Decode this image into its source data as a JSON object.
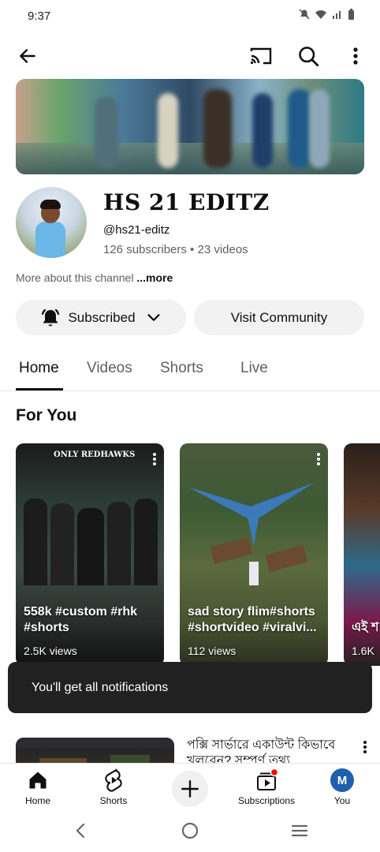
{
  "status_bar": {
    "time": "9:37"
  },
  "channel": {
    "name": "HS 21 EDITZ",
    "handle": "@hs21-editz",
    "stats": "126 subscribers • 23 videos",
    "about_prefix": "More about this channel",
    "about_more": "...more"
  },
  "actions": {
    "subscribed_label": "Subscribed",
    "visit_community_label": "Visit Community"
  },
  "tabs": [
    {
      "label": "Home",
      "active": true
    },
    {
      "label": "Videos",
      "active": false
    },
    {
      "label": "Shorts",
      "active": false
    },
    {
      "label": "Live",
      "active": false
    }
  ],
  "section": {
    "title": "For You"
  },
  "shorts": [
    {
      "title": "558k #custom #rhk #shorts",
      "views": "2.5K views",
      "overlay_text": "ONLY REDHAWKS"
    },
    {
      "title": "sad story flim#shorts #shortvideo #viralvi...",
      "views": "112 views"
    },
    {
      "title": "এই শ দুইটা",
      "views": "1.6K"
    }
  ],
  "toast": {
    "message": "You'll get all notifications"
  },
  "video": {
    "title": "পক্সি সার্ভারে একাউন্ট কিভাবে খুলবেন? সম্পূর্ণ তথ্য"
  },
  "bottom_nav": {
    "home": "Home",
    "shorts": "Shorts",
    "subscriptions": "Subscriptions",
    "you": "You",
    "you_initial": "M"
  },
  "colors": {
    "accent": "#ff0000",
    "avatar": "#1e5fae",
    "toast_bg": "#212121"
  }
}
